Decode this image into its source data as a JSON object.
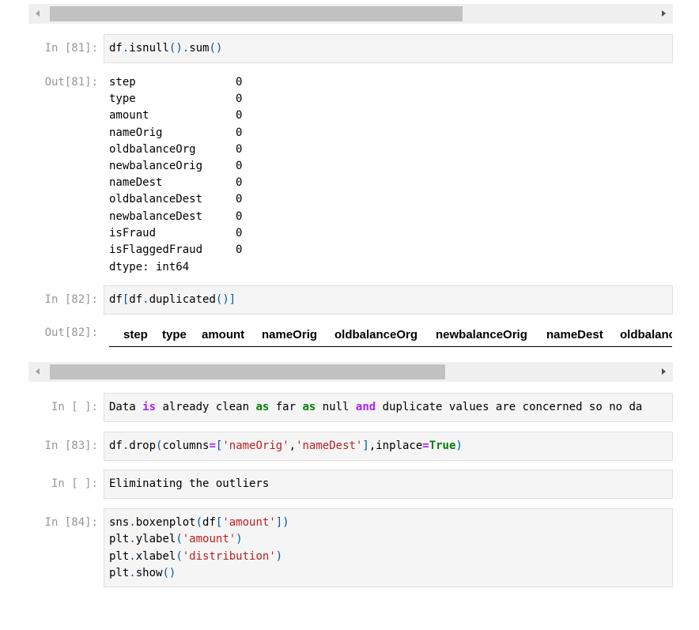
{
  "cell81": {
    "in_prompt": "In [81]:",
    "out_prompt": "Out[81]:",
    "code": "df.isnull().sum()",
    "output_rows": [
      {
        "name": "step",
        "value": "0"
      },
      {
        "name": "type",
        "value": "0"
      },
      {
        "name": "amount",
        "value": "0"
      },
      {
        "name": "nameOrig",
        "value": "0"
      },
      {
        "name": "oldbalanceOrg",
        "value": "0"
      },
      {
        "name": "newbalanceOrig",
        "value": "0"
      },
      {
        "name": "nameDest",
        "value": "0"
      },
      {
        "name": "oldbalanceDest",
        "value": "0"
      },
      {
        "name": "newbalanceDest",
        "value": "0"
      },
      {
        "name": "isFraud",
        "value": "0"
      },
      {
        "name": "isFlaggedFraud",
        "value": "0"
      }
    ],
    "dtype": "dtype: int64"
  },
  "cell82": {
    "in_prompt": "In [82]:",
    "out_prompt": "Out[82]:",
    "code": "df[df.duplicated()]",
    "columns": [
      "step",
      "type",
      "amount",
      "nameOrig",
      "oldbalanceOrg",
      "newbalanceOrig",
      "nameDest",
      "oldbalanceDest"
    ]
  },
  "markdown1": {
    "in_prompt": "In [ ]:",
    "text_parts": [
      "Data ",
      "is",
      " already clean ",
      "as",
      " far ",
      "as",
      " null ",
      "and",
      " duplicate values are concerned so no da"
    ]
  },
  "cell83": {
    "in_prompt": "In [83]:",
    "parts": [
      "df.drop(columns=[",
      "'nameOrig'",
      ",",
      "'nameDest'",
      "],inplace=",
      "True",
      ")"
    ]
  },
  "markdown2": {
    "in_prompt": "In [ ]:",
    "text": "Eliminating the outliers"
  },
  "cell84": {
    "in_prompt": "In [84]:",
    "lines": [
      [
        "sns.boxenplot(df[",
        "'amount'",
        "])"
      ],
      [
        "plt.ylabel(",
        "'amount'",
        ")"
      ],
      [
        "plt.xlabel(",
        "'distribution'",
        ")"
      ],
      [
        "plt.show()"
      ]
    ]
  }
}
